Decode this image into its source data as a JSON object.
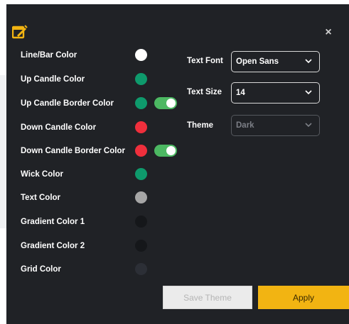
{
  "dialog": {
    "color_settings": [
      {
        "label": "Line/Bar Color",
        "color": "#ffffff",
        "has_toggle": false
      },
      {
        "label": "Up Candle Color",
        "color": "#0e9a6c",
        "has_toggle": false
      },
      {
        "label": "Up Candle Border Color",
        "color": "#0e9a6c",
        "has_toggle": true,
        "toggle_on": true
      },
      {
        "label": "Down Candle Color",
        "color": "#ef2f3c",
        "has_toggle": false
      },
      {
        "label": "Down Candle Border Color",
        "color": "#ef2f3c",
        "has_toggle": true,
        "toggle_on": true
      },
      {
        "label": "Wick Color",
        "color": "#0e9a6c",
        "has_toggle": false
      },
      {
        "label": "Text Color",
        "color": "#a6a6a6",
        "has_toggle": false
      },
      {
        "label": "Gradient Color 1",
        "color": "#15171a",
        "has_toggle": false
      },
      {
        "label": "Gradient Color 2",
        "color": "#15171a",
        "has_toggle": false
      },
      {
        "label": "Grid Color",
        "color": "#2c2f36",
        "has_toggle": false
      }
    ],
    "text_font": {
      "label": "Text Font",
      "value": "Open Sans"
    },
    "text_size": {
      "label": "Text Size",
      "value": "14"
    },
    "theme": {
      "label": "Theme",
      "value": "Dark",
      "disabled": true
    },
    "save_theme_label": "Save Theme",
    "apply_label": "Apply",
    "close_icon": "close-icon",
    "logo_icon": "chart-settings-icon",
    "accent_color": "#f2b412",
    "toggle_color": "#4cb862"
  }
}
